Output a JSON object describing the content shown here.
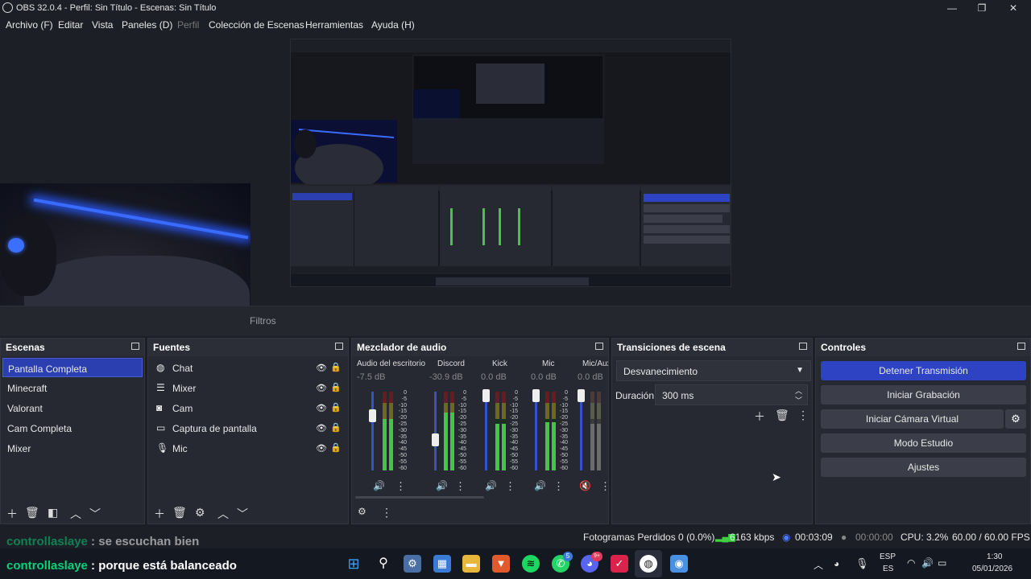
{
  "window": {
    "title": "OBS 32.0.4 - Perfil: Sin Título - Escenas: Sin Título",
    "minimize": "—",
    "maximize": "❐",
    "close": "✕"
  },
  "menu": [
    "Archivo (F)",
    "Editar",
    "Vista",
    "Paneles (D)",
    "Perfil",
    "Colección de Escenas",
    "Herramientas",
    "Ayuda (H)"
  ],
  "tabs": {
    "filters": "Filtros"
  },
  "scenes": {
    "title": "Escenas",
    "items": [
      "Pantalla Completa",
      "Minecraft",
      "Valorant",
      "Cam Completa",
      "Mixer"
    ],
    "selected": "Pantalla Completa"
  },
  "sources": {
    "title": "Fuentes",
    "items": [
      {
        "label": "Chat",
        "icon": "globe-icon"
      },
      {
        "label": "Mixer",
        "icon": "list-icon"
      },
      {
        "label": "Cam",
        "icon": "camera-icon"
      },
      {
        "label": "Captura de pantalla",
        "icon": "monitor-icon"
      },
      {
        "label": "Mic",
        "icon": "microphone-icon"
      }
    ]
  },
  "mixer": {
    "title": "Mezclador de audio",
    "channels": [
      {
        "name": "Audio del escritorio",
        "db": "-7.5 dB"
      },
      {
        "name": "Discord",
        "db": "-30.9 dB"
      },
      {
        "name": "Kick",
        "db": "0.0 dB"
      },
      {
        "name": "Mic",
        "db": "0.0 dB"
      },
      {
        "name": "Mic/Aux",
        "db": "0.0 dB"
      }
    ],
    "scale": [
      "0",
      "-5",
      "-10",
      "-15",
      "-20",
      "-25",
      "-30",
      "-35",
      "-40",
      "-45",
      "-50",
      "-55",
      "-60"
    ]
  },
  "transitions": {
    "title": "Transiciones de escena",
    "selected": "Desvanecimiento",
    "duration_label": "Duración",
    "duration_value": "300 ms"
  },
  "controls": {
    "title": "Controles",
    "stop_stream": "Detener Transmisión",
    "start_recording": "Iniciar Grabación",
    "start_virtual_cam": "Iniciar Cámara Virtual",
    "studio_mode": "Modo Estudio",
    "settings": "Ajustes"
  },
  "status": {
    "dropped_frames": "Fotogramas Perdidos 0 (0.0%)",
    "bitrate": "6163 kbps",
    "stream_time": "00:03:09",
    "rec_time": "00:00:00",
    "cpu": "CPU: 3.2%",
    "fps": "60.00 / 60.00 FPS"
  },
  "chat_overlay": [
    {
      "user": "controllaslaye",
      "message": " : se escuchan bien"
    },
    {
      "user": "controllaslaye",
      "message": " : porque está balanceado"
    }
  ],
  "taskbar": {
    "lang_top": "ESP",
    "lang_bottom": "ES",
    "time": "1:30",
    "date": "05/01/2026",
    "whatsapp_badge": "5",
    "discord_badge": "9+"
  },
  "colors": {
    "accent": "#2d43c4",
    "chat_user": "#00d27a",
    "meter_green": "#44c544",
    "fader_blue": "#3552c9"
  }
}
